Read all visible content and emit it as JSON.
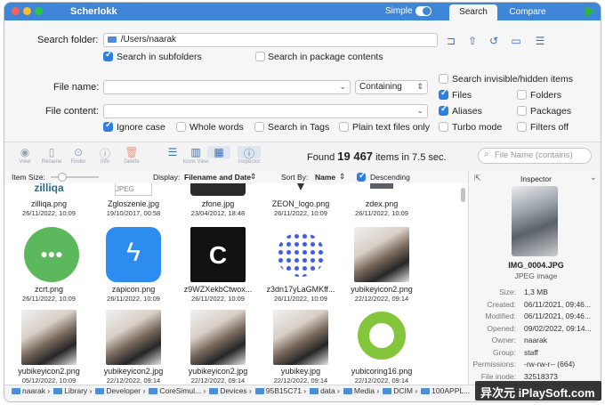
{
  "app": {
    "title": "Scherlokk",
    "mode_label": "Simple",
    "tabs": [
      "Search",
      "Compare"
    ]
  },
  "search": {
    "folder_label": "Search folder:",
    "folder_path": "/Users/naarak",
    "in_subfolders": "Search in subfolders",
    "in_package_contents": "Search in package contents",
    "file_name_label": "File name:",
    "file_name_mode": "Containing",
    "file_content_label": "File content:",
    "ignore_case": "Ignore case",
    "whole_words": "Whole words",
    "search_in_tags": "Search in Tags",
    "plain_text_only": "Plain text files only",
    "invisible": "Search invisible/hidden items",
    "files": "Files",
    "folders": "Folders",
    "aliases": "Aliases",
    "packages": "Packages",
    "turbo": "Turbo mode",
    "filters_off": "Filters off"
  },
  "toolbar": {
    "items": [
      "View",
      "Rename",
      "Finder",
      "Info",
      "Delete",
      "",
      "Icons View",
      "",
      "Inspector"
    ],
    "found_prefix": "Found",
    "found_count": "19 467",
    "found_suffix": "items in 7.5 sec.",
    "search_placeholder": "File Name (contains)"
  },
  "options": {
    "item_size": "Item Size:",
    "display_label": "Display:",
    "display_value": "Filename and Date",
    "sort_label": "Sort By:",
    "sort_value": "Name",
    "descending": "Descending"
  },
  "files": [
    {
      "name": "zilliqa.png",
      "date": "26/11/2022, 10:09",
      "kind": "zilliqa"
    },
    {
      "name": "Zgloszenie.jpg",
      "date": "19/10/2017, 00:58",
      "kind": "jpeg"
    },
    {
      "name": "zfone.jpg",
      "date": "23/04/2012, 18:48",
      "kind": "dark"
    },
    {
      "name": "ZEON_logo.png",
      "date": "26/11/2022, 10:09",
      "kind": "zeon"
    },
    {
      "name": "zdex.png",
      "date": "26/11/2022, 10:09",
      "kind": "zdex"
    },
    {
      "name": "zcrt.png",
      "date": "26/11/2022, 10:09",
      "kind": "green"
    },
    {
      "name": "zapicon.png",
      "date": "26/11/2022, 10:09",
      "kind": "zap"
    },
    {
      "name": "z9WZXekbCtwox...",
      "date": "26/11/2022, 10:09",
      "kind": "cblack"
    },
    {
      "name": "z3dn17yLaGMKff...",
      "date": "26/11/2022, 10:09",
      "kind": "dots"
    },
    {
      "name": "yubikeyicon2.png",
      "date": "22/12/2022, 09:14",
      "kind": "photo"
    },
    {
      "name": "yubikeyicon2.png",
      "date": "05/12/2022, 10:09",
      "kind": "photo"
    },
    {
      "name": "yubikeyicon2.jpg",
      "date": "22/12/2022, 09:14",
      "kind": "photo"
    },
    {
      "name": "yubikeyicon2.jpg",
      "date": "22/12/2022, 09:14",
      "kind": "photo"
    },
    {
      "name": "yubikey.jpg",
      "date": "22/12/2022, 09:14",
      "kind": "photo"
    },
    {
      "name": "yubicoring16.png",
      "date": "22/12/2022, 09:14",
      "kind": "ring"
    }
  ],
  "inspector": {
    "title": "Inspector",
    "file_name": "IMG_0004.JPG",
    "file_kind": "JPEG image",
    "rows": [
      {
        "k": "Size:",
        "v": "1,3 MB"
      },
      {
        "k": "Created:",
        "v": "06/11/2021, 09:46..."
      },
      {
        "k": "Modified:",
        "v": "06/11/2021, 09:46..."
      },
      {
        "k": "Opened:",
        "v": "09/02/2022, 09:14..."
      },
      {
        "k": "Owner:",
        "v": "naarak"
      },
      {
        "k": "Group:",
        "v": "staff"
      },
      {
        "k": "Permissions:",
        "v": "-rw-rw-r-- (664)"
      },
      {
        "k": "File inode:",
        "v": "32518373"
      }
    ]
  },
  "path": [
    "naarak",
    "Library",
    "Developer",
    "CoreSimul...",
    "Devices",
    "95B15C71",
    "data",
    "Media",
    "DCIM",
    "100APPL..."
  ],
  "watermark": "异次元 iPlaySoft.com",
  "colors": {
    "accent": "#3f86d8",
    "check": "#2f7fe0"
  }
}
